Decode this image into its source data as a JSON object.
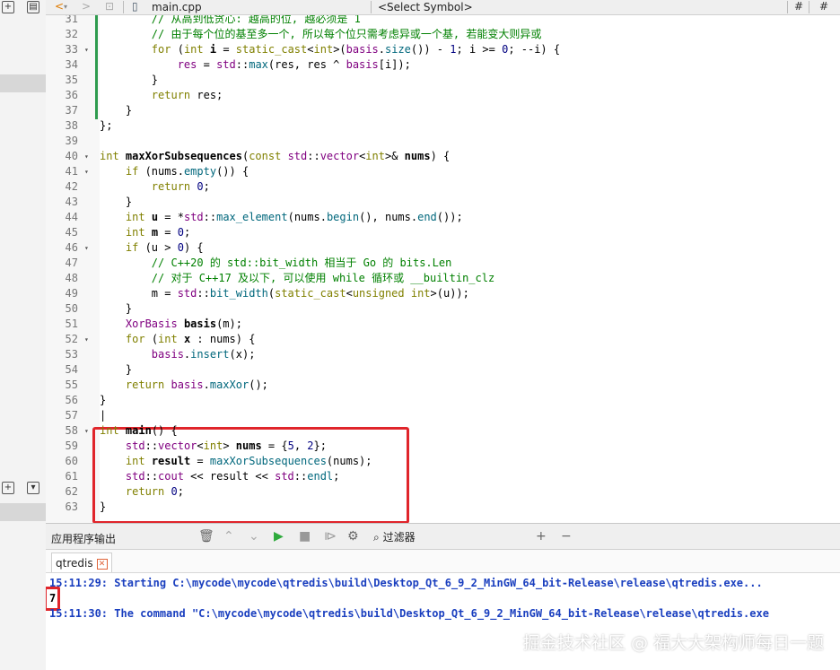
{
  "toolbar": {
    "file_name": "main.cpp",
    "symbol_select": "<Select Symbol>",
    "hash": "#"
  },
  "code_lines": [
    {
      "n": "31",
      "fold": "",
      "segs": [
        [
          "cm",
          "        // 从高到低贪心: 越高的位, 越必须是 1"
        ]
      ]
    },
    {
      "n": "32",
      "fold": "",
      "segs": [
        [
          "cm",
          "        // 由于每个位的基至多一个, 所以每个位只需考虑异或一个基, 若能变大则异或"
        ]
      ]
    },
    {
      "n": "33",
      "fold": "▾",
      "segs": [
        [
          "",
          "        "
        ],
        [
          "kw",
          "for"
        ],
        [
          "",
          " ("
        ],
        [
          "kw",
          "int"
        ],
        [
          "",
          " "
        ],
        [
          "bold",
          "i"
        ],
        [
          "",
          " = "
        ],
        [
          "kw",
          "static_cast"
        ],
        [
          "",
          "<"
        ],
        [
          "kw",
          "int"
        ],
        [
          "",
          ">("
        ],
        [
          "ty",
          "basis"
        ],
        [
          "",
          "."
        ],
        [
          "fn",
          "size"
        ],
        [
          "",
          "()) - "
        ],
        [
          "num",
          "1"
        ],
        [
          "",
          "; i >= "
        ],
        [
          "num",
          "0"
        ],
        [
          "",
          "; --i) {"
        ]
      ]
    },
    {
      "n": "34",
      "fold": "",
      "segs": [
        [
          "",
          "            "
        ],
        [
          "ty",
          "res"
        ],
        [
          "",
          " = "
        ],
        [
          "ty",
          "std"
        ],
        [
          "",
          "::"
        ],
        [
          "fn",
          "max"
        ],
        [
          "",
          "(res, res ^ "
        ],
        [
          "ty",
          "basis"
        ],
        [
          "",
          "[i]);"
        ]
      ]
    },
    {
      "n": "35",
      "fold": "",
      "segs": [
        [
          "",
          "        }"
        ]
      ]
    },
    {
      "n": "36",
      "fold": "",
      "segs": [
        [
          "",
          "        "
        ],
        [
          "kw",
          "return"
        ],
        [
          "",
          " res;"
        ]
      ]
    },
    {
      "n": "37",
      "fold": "",
      "segs": [
        [
          "",
          "    }"
        ]
      ]
    },
    {
      "n": "38",
      "fold": "",
      "segs": [
        [
          "",
          "};"
        ]
      ]
    },
    {
      "n": "39",
      "fold": "",
      "segs": [
        [
          "",
          ""
        ]
      ]
    },
    {
      "n": "40",
      "fold": "▾",
      "segs": [
        [
          "kw",
          "int"
        ],
        [
          "",
          " "
        ],
        [
          "bold",
          "maxXorSubsequences"
        ],
        [
          "",
          "("
        ],
        [
          "kw",
          "const"
        ],
        [
          "",
          " "
        ],
        [
          "ty",
          "std"
        ],
        [
          "",
          "::"
        ],
        [
          "ty",
          "vector"
        ],
        [
          "",
          "<"
        ],
        [
          "kw",
          "int"
        ],
        [
          "",
          ">& "
        ],
        [
          "bold",
          "nums"
        ],
        [
          "",
          ") {"
        ]
      ]
    },
    {
      "n": "41",
      "fold": "▾",
      "segs": [
        [
          "",
          "    "
        ],
        [
          "kw",
          "if"
        ],
        [
          "",
          " (nums."
        ],
        [
          "fn",
          "empty"
        ],
        [
          "",
          "()) {"
        ]
      ]
    },
    {
      "n": "42",
      "fold": "",
      "segs": [
        [
          "",
          "        "
        ],
        [
          "kw",
          "return"
        ],
        [
          "",
          " "
        ],
        [
          "num",
          "0"
        ],
        [
          "",
          ";"
        ]
      ]
    },
    {
      "n": "43",
      "fold": "",
      "segs": [
        [
          "",
          "    }"
        ]
      ]
    },
    {
      "n": "44",
      "fold": "",
      "segs": [
        [
          "",
          "    "
        ],
        [
          "kw",
          "int"
        ],
        [
          "",
          " "
        ],
        [
          "bold",
          "u"
        ],
        [
          "",
          " = *"
        ],
        [
          "ty",
          "std"
        ],
        [
          "",
          "::"
        ],
        [
          "fn",
          "max_element"
        ],
        [
          "",
          "(nums."
        ],
        [
          "fn",
          "begin"
        ],
        [
          "",
          "(), nums."
        ],
        [
          "fn",
          "end"
        ],
        [
          "",
          "());"
        ]
      ]
    },
    {
      "n": "45",
      "fold": "",
      "segs": [
        [
          "",
          "    "
        ],
        [
          "kw",
          "int"
        ],
        [
          "",
          " "
        ],
        [
          "bold",
          "m"
        ],
        [
          "",
          " = "
        ],
        [
          "num",
          "0"
        ],
        [
          "",
          ";"
        ]
      ]
    },
    {
      "n": "46",
      "fold": "▾",
      "segs": [
        [
          "",
          "    "
        ],
        [
          "kw",
          "if"
        ],
        [
          "",
          " (u > "
        ],
        [
          "num",
          "0"
        ],
        [
          "",
          ") {"
        ]
      ]
    },
    {
      "n": "47",
      "fold": "",
      "segs": [
        [
          "cm",
          "        // C++20 的 std::bit_width 相当于 Go 的 bits.Len"
        ]
      ]
    },
    {
      "n": "48",
      "fold": "",
      "segs": [
        [
          "cm",
          "        // 对于 C++17 及以下, 可以使用 while 循环或 __builtin_clz"
        ]
      ]
    },
    {
      "n": "49",
      "fold": "",
      "segs": [
        [
          "",
          "        m = "
        ],
        [
          "ty",
          "std"
        ],
        [
          "",
          "::"
        ],
        [
          "fn",
          "bit_width"
        ],
        [
          "",
          "("
        ],
        [
          "kw",
          "static_cast"
        ],
        [
          "",
          "<"
        ],
        [
          "kw",
          "unsigned int"
        ],
        [
          "",
          ">(u));"
        ]
      ]
    },
    {
      "n": "50",
      "fold": "",
      "segs": [
        [
          "",
          "    }"
        ]
      ]
    },
    {
      "n": "51",
      "fold": "",
      "segs": [
        [
          "",
          "    "
        ],
        [
          "ty",
          "XorBasis"
        ],
        [
          "",
          " "
        ],
        [
          "bold",
          "basis"
        ],
        [
          "",
          "(m);"
        ]
      ]
    },
    {
      "n": "52",
      "fold": "▾",
      "segs": [
        [
          "",
          "    "
        ],
        [
          "kw",
          "for"
        ],
        [
          "",
          " ("
        ],
        [
          "kw",
          "int"
        ],
        [
          "",
          " "
        ],
        [
          "bold",
          "x"
        ],
        [
          "",
          " : nums) {"
        ]
      ]
    },
    {
      "n": "53",
      "fold": "",
      "segs": [
        [
          "",
          "        "
        ],
        [
          "ty",
          "basis"
        ],
        [
          "",
          "."
        ],
        [
          "fn",
          "insert"
        ],
        [
          "",
          "(x);"
        ]
      ]
    },
    {
      "n": "54",
      "fold": "",
      "segs": [
        [
          "",
          "    }"
        ]
      ]
    },
    {
      "n": "55",
      "fold": "",
      "segs": [
        [
          "",
          "    "
        ],
        [
          "kw",
          "return"
        ],
        [
          "",
          " "
        ],
        [
          "ty",
          "basis"
        ],
        [
          "",
          "."
        ],
        [
          "fn",
          "maxXor"
        ],
        [
          "",
          "();"
        ]
      ]
    },
    {
      "n": "56",
      "fold": "",
      "segs": [
        [
          "",
          "}"
        ]
      ]
    },
    {
      "n": "57",
      "fold": "",
      "segs": [
        [
          "",
          "|"
        ]
      ]
    },
    {
      "n": "58",
      "fold": "▾",
      "segs": [
        [
          "kw",
          "int"
        ],
        [
          "",
          " "
        ],
        [
          "bold",
          "main"
        ],
        [
          "",
          "() {"
        ]
      ]
    },
    {
      "n": "59",
      "fold": "",
      "segs": [
        [
          "",
          "    "
        ],
        [
          "ty",
          "std"
        ],
        [
          "",
          "::"
        ],
        [
          "ty",
          "vector"
        ],
        [
          "",
          "<"
        ],
        [
          "kw",
          "int"
        ],
        [
          "",
          "> "
        ],
        [
          "bold",
          "nums"
        ],
        [
          "",
          " = {"
        ],
        [
          "num",
          "5"
        ],
        [
          "",
          ", "
        ],
        [
          "num",
          "2"
        ],
        [
          "",
          "};"
        ]
      ]
    },
    {
      "n": "60",
      "fold": "",
      "segs": [
        [
          "",
          "    "
        ],
        [
          "kw",
          "int"
        ],
        [
          "",
          " "
        ],
        [
          "bold",
          "result"
        ],
        [
          "",
          " = "
        ],
        [
          "fn",
          "maxXorSubsequences"
        ],
        [
          "",
          "(nums);"
        ]
      ]
    },
    {
      "n": "61",
      "fold": "",
      "segs": [
        [
          "",
          "    "
        ],
        [
          "ty",
          "std"
        ],
        [
          "",
          "::"
        ],
        [
          "ty",
          "cout"
        ],
        [
          "",
          " << result << "
        ],
        [
          "ty",
          "std"
        ],
        [
          "",
          "::"
        ],
        [
          "fn",
          "endl"
        ],
        [
          "",
          ";"
        ]
      ]
    },
    {
      "n": "62",
      "fold": "",
      "segs": [
        [
          "",
          "    "
        ],
        [
          "kw",
          "return"
        ],
        [
          "",
          " "
        ],
        [
          "num",
          "0"
        ],
        [
          "",
          ";"
        ]
      ]
    },
    {
      "n": "63",
      "fold": "",
      "segs": [
        [
          "",
          "}"
        ]
      ]
    }
  ],
  "output_pane": {
    "title": "应用程序输出",
    "filter_placeholder": "过滤器",
    "tab_label": "qtredis",
    "tab_close": "✕",
    "lines": [
      "15:11:29: Starting C:\\mycode\\mycode\\qtredis\\build\\Desktop_Qt_6_9_2_MinGW_64_bit-Release\\release\\qtredis.exe...",
      "7",
      "15:11:30: The command \"C:\\mycode\\mycode\\qtredis\\build\\Desktop_Qt_6_9_2_MinGW_64_bit-Release\\release\\qtredis.exe"
    ]
  },
  "watermark": "掘金技术社区 @ 福大大架构师每日一题",
  "colors": {
    "keyword": "#808000",
    "type": "#800080",
    "function": "#00677c",
    "number": "#000080",
    "comment": "#008000",
    "highlight_box": "#e0252b",
    "output_text": "#1a3fbf"
  }
}
